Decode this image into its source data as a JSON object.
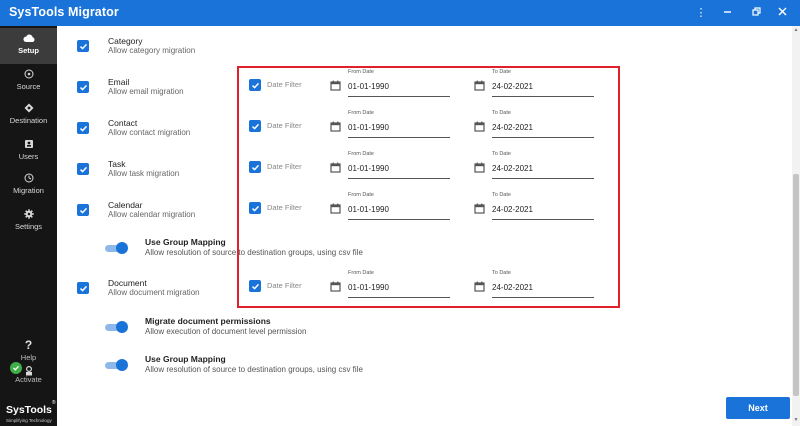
{
  "window": {
    "title": "SysTools Migrator",
    "controls": [
      "⋮",
      "minimize",
      "restore",
      "close"
    ]
  },
  "sidebar": {
    "items": [
      {
        "label": "Setup",
        "icon": "cloud-icon",
        "active": true
      },
      {
        "label": "Source",
        "icon": "source-icon",
        "active": false
      },
      {
        "label": "Destination",
        "icon": "destination-icon",
        "active": false
      },
      {
        "label": "Users",
        "icon": "users-icon",
        "active": false
      },
      {
        "label": "Migration",
        "icon": "migration-icon",
        "active": false
      },
      {
        "label": "Settings",
        "icon": "gear-icon",
        "active": false
      }
    ],
    "help": {
      "symbol": "?",
      "label": "Help"
    },
    "activate": {
      "label": "Activate"
    },
    "brand": {
      "name": "SysTools",
      "reg": "®",
      "tagline": "Simplifying Technology"
    }
  },
  "main": {
    "categories": [
      {
        "title": "Category",
        "subtitle": "Allow category migration",
        "checked": true
      },
      {
        "title": "Email",
        "subtitle": "Allow email migration",
        "checked": true
      },
      {
        "title": "Contact",
        "subtitle": "Allow contact migration",
        "checked": true
      },
      {
        "title": "Task",
        "subtitle": "Allow task migration",
        "checked": true
      },
      {
        "title": "Calendar",
        "subtitle": "Allow calendar migration",
        "checked": true
      },
      {
        "title": "Document",
        "subtitle": "Allow document migration",
        "checked": true
      }
    ],
    "toggles": [
      {
        "title": "Use Group Mapping",
        "subtitle": "Allow resolution of source to destination groups, using csv file",
        "on": true
      },
      {
        "title": "Migrate document permissions",
        "subtitle": "Allow execution of document level permission",
        "on": true
      },
      {
        "title": "Use Group Mapping",
        "subtitle": "Allow resolution of source to destination groups, using csv file",
        "on": true
      }
    ],
    "date_filters": [
      {
        "label": "Date Filter",
        "checked": true,
        "from_caption": "From Date",
        "from": "01-01-1990",
        "to_caption": "To Date",
        "to": "24-02-2021"
      },
      {
        "label": "Date Filter",
        "checked": true,
        "from_caption": "From Date",
        "from": "01-01-1990",
        "to_caption": "To Date",
        "to": "24-02-2021"
      },
      {
        "label": "Date Filter",
        "checked": true,
        "from_caption": "From Date",
        "from": "01-01-1990",
        "to_caption": "To Date",
        "to": "24-02-2021"
      },
      {
        "label": "Date Filter",
        "checked": true,
        "from_caption": "From Date",
        "from": "01-01-1990",
        "to_caption": "To Date",
        "to": "24-02-2021"
      },
      {
        "label": "Date Filter",
        "checked": true,
        "from_caption": "From Date",
        "from": "01-01-1990",
        "to_caption": "To Date",
        "to": "24-02-2021"
      }
    ],
    "next_label": "Next"
  },
  "colors": {
    "accent": "#1a73d9",
    "sidebar_bg": "#151515",
    "highlight_border": "#e0212b",
    "activate_badge": "#3fae49"
  }
}
